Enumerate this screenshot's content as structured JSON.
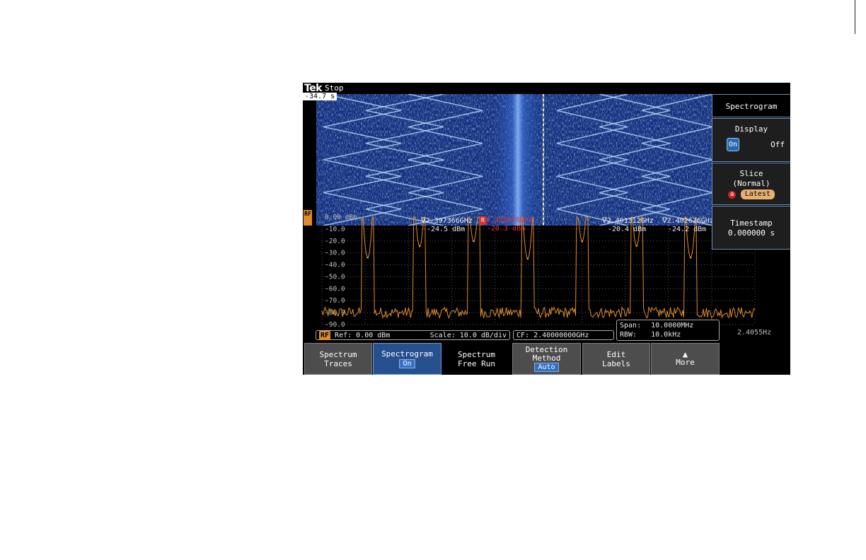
{
  "header": {
    "brand": "Tek",
    "status": "Stop",
    "timestamp_overlay": "-34.7 s"
  },
  "channel_badge": "RF",
  "colors": {
    "trace": "#e08c2a",
    "reference_marker": "#e03030",
    "button_active": "#27508f",
    "accent_orange": "#e08c2a"
  },
  "markers": [
    {
      "freq": "2.397366GHz",
      "amp": "-24.5 dBm",
      "is_reference": false,
      "reference_label": ""
    },
    {
      "freq": "2.398676GHz",
      "amp": "-20.3 dBm",
      "is_reference": true,
      "reference_label": "R"
    },
    {
      "freq": "2.401312GHz",
      "amp": "-20.4 dBm",
      "is_reference": false,
      "reference_label": ""
    },
    {
      "freq": "2.402626GHz",
      "amp": "-24.2 dBm",
      "is_reference": false,
      "reference_label": ""
    }
  ],
  "readouts": {
    "rf_label": "RF",
    "ref": "Ref: 0.00 dBm",
    "scale": "Scale: 10.0 dB/div",
    "cf": "CF:  2.40000000GHz",
    "span_label": "Span:",
    "span_value": "10.0000MHz",
    "rbw_label": "RBW:",
    "rbw_value": "10.0kHz",
    "end_freq": "2.4055Hz"
  },
  "side_menu": {
    "title": "Spectrogram",
    "display_label": "Display",
    "display_on": "On",
    "display_off": "Off",
    "slice_label": "Slice",
    "slice_mode": "(Normal)",
    "slice_chip": "a",
    "slice_value": "Latest",
    "timestamp_label": "Timestamp",
    "timestamp_value": "0.000000 s"
  },
  "bottom_menu": [
    {
      "line1": "Spectrum",
      "line2": "Traces",
      "badge": ""
    },
    {
      "line1": "Spectrogram",
      "line2": "",
      "badge": "On"
    },
    {
      "line1": "Spectrum",
      "line2": "Free Run",
      "badge": ""
    },
    {
      "line1": "Detection",
      "line2": "Method",
      "badge": "Auto"
    },
    {
      "line1": "Edit",
      "line2": "Labels",
      "badge": ""
    },
    {
      "line1": "More",
      "line2": "",
      "badge": ""
    }
  ],
  "chart_data": {
    "type": "line",
    "title": "",
    "xlabel": "",
    "ylabel": "dBm",
    "y_tick_labels": [
      "0.00 dBm",
      "-10.0",
      "-20.0",
      "-30.0",
      "-40.0",
      "-50.0",
      "-60.0",
      "-70.0",
      "-80.0",
      "-90.0"
    ],
    "ylim": [
      -90,
      0
    ],
    "xlim": [
      "2.3950GHz",
      "2.4055GHz"
    ],
    "noise_floor_dbm": -80,
    "peaks": [
      {
        "x": 2.39611,
        "y": -34
      },
      {
        "x": 2.39737,
        "y": -24.5
      },
      {
        "x": 2.39868,
        "y": -20.3
      },
      {
        "x": 2.39999,
        "y": -35
      },
      {
        "x": 2.40131,
        "y": -20.4
      },
      {
        "x": 2.40263,
        "y": -24.2
      },
      {
        "x": 2.40394,
        "y": -34
      }
    ],
    "series": [
      {
        "name": "",
        "color": "#e08c2a"
      }
    ],
    "grid": true
  }
}
